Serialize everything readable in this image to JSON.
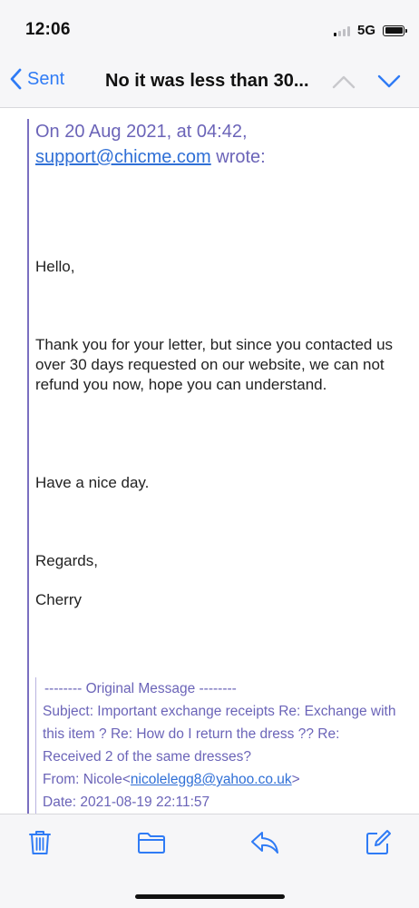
{
  "status_bar": {
    "time": "12:06",
    "network": "5G"
  },
  "nav": {
    "back_label": "Sent",
    "title": "No it was less than 30..."
  },
  "email": {
    "quote_header_line1": "On 20 Aug 2021, at 04:42,",
    "quote_sender_email": "support@chicme.com",
    "quote_header_suffix": " wrote:",
    "greeting": "Hello,",
    "paragraph": "Thank you for your letter, but since you contacted us over 30 days requested on our website, we can not refund you now, hope you can understand.",
    "closing": "Have a nice day.",
    "regards": "Regards,",
    "signature": "Cherry",
    "original": {
      "header": "-------- Original Message --------",
      "subject": "Subject: Important exchange receipts Re: Exchange with this item ? Re: How do I return the dress ?? Re: Received 2 of the same dresses?",
      "from_prefix": "From: Nicole<",
      "from_email": "nicolelegg8@yahoo.co.uk",
      "from_suffix": ">",
      "date": "Date: 2021-08-19 22:11:57"
    }
  },
  "toolbar": {
    "icons": [
      "trash-icon",
      "folder-icon",
      "reply-icon",
      "compose-icon"
    ]
  },
  "colors": {
    "accent": "#2f7bf5",
    "quote": "#6b64b8"
  }
}
